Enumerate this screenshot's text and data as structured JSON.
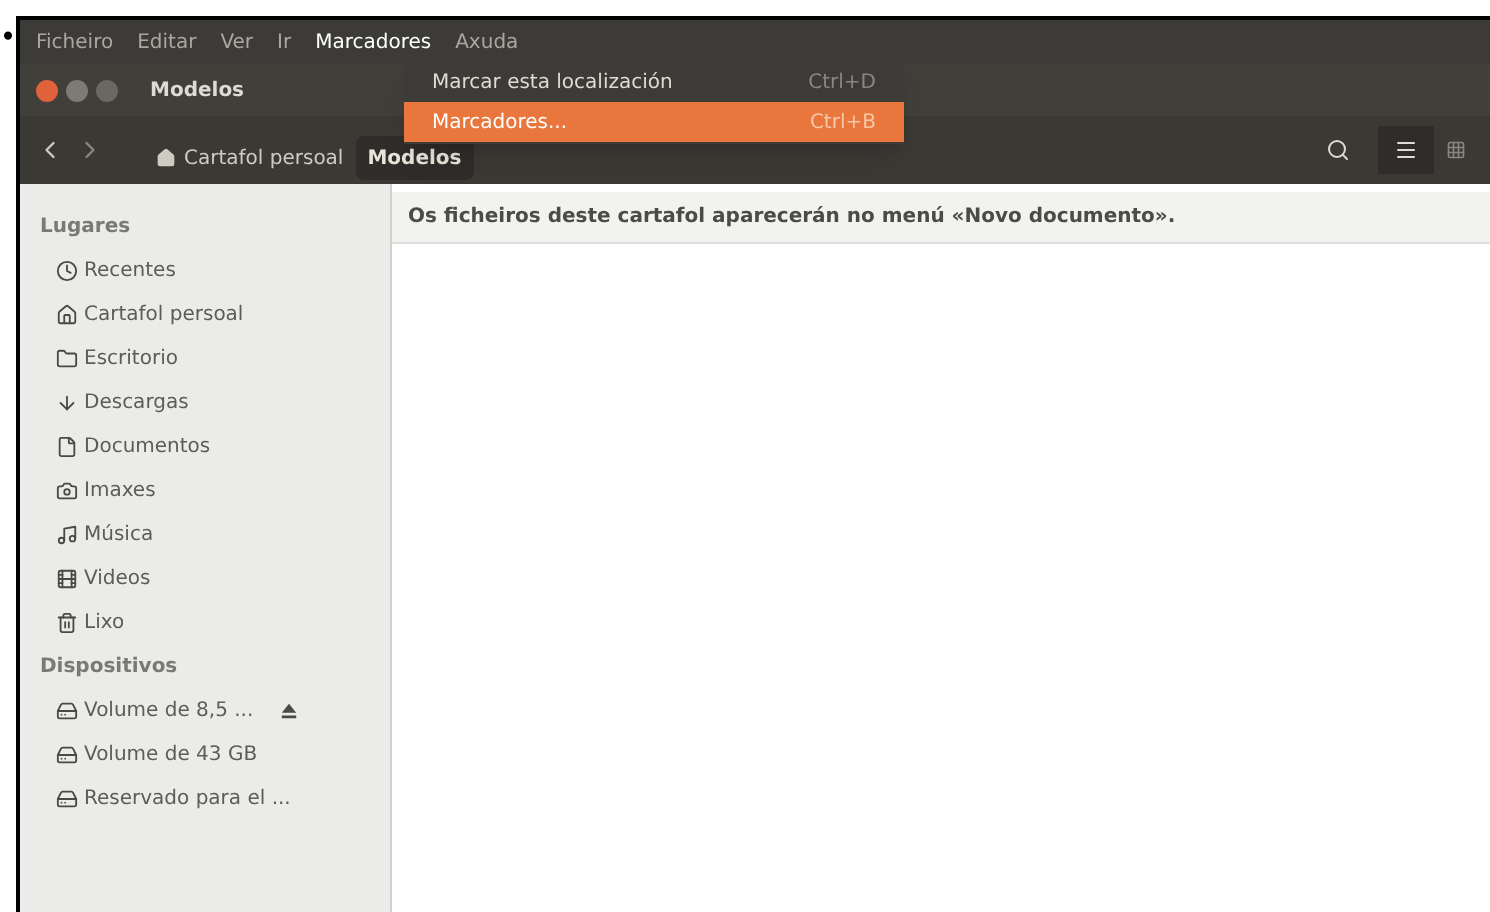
{
  "bullet": "•",
  "menubar": [
    {
      "label": "Ficheiro",
      "selected": false
    },
    {
      "label": "Editar",
      "selected": false
    },
    {
      "label": "Ver",
      "selected": false
    },
    {
      "label": "Ir",
      "selected": false
    },
    {
      "label": "Marcadores",
      "selected": true
    },
    {
      "label": "Axuda",
      "selected": false
    }
  ],
  "menu": [
    {
      "label": "Marcar esta localización",
      "shortcut": "Ctrl+D",
      "selected": false
    },
    {
      "label": "Marcadores...",
      "shortcut": "Ctrl+B",
      "selected": true
    }
  ],
  "window": {
    "title": "Modelos"
  },
  "path": [
    {
      "label": "Cartafol persoal",
      "selected": false
    },
    {
      "label": "Modelos",
      "selected": true
    }
  ],
  "sidebar": [
    {
      "heading": "Lugares",
      "items": [
        {
          "label": "Recentes",
          "kind": "clock"
        },
        {
          "label": "Cartafol persoal",
          "kind": "home"
        },
        {
          "label": "Escritorio",
          "kind": "folder"
        },
        {
          "label": "Descargas",
          "kind": "download"
        },
        {
          "label": "Documentos",
          "kind": "document"
        },
        {
          "label": "Imaxes",
          "kind": "camera"
        },
        {
          "label": "Música",
          "kind": "music"
        },
        {
          "label": "Videos",
          "kind": "film"
        },
        {
          "label": "Lixo",
          "kind": "trash"
        }
      ]
    },
    {
      "heading": "Dispositivos",
      "items": [
        {
          "label": "Volume de 8,5 ...",
          "kind": "drive",
          "eject": true
        },
        {
          "label": "Volume de 43 GB",
          "kind": "drive",
          "eject": false
        },
        {
          "label": "Reservado para el ...",
          "kind": "drive",
          "eject": false
        }
      ]
    }
  ],
  "info": "Os ficheiros deste cartafol aparecerán no menú «Novo documento»."
}
